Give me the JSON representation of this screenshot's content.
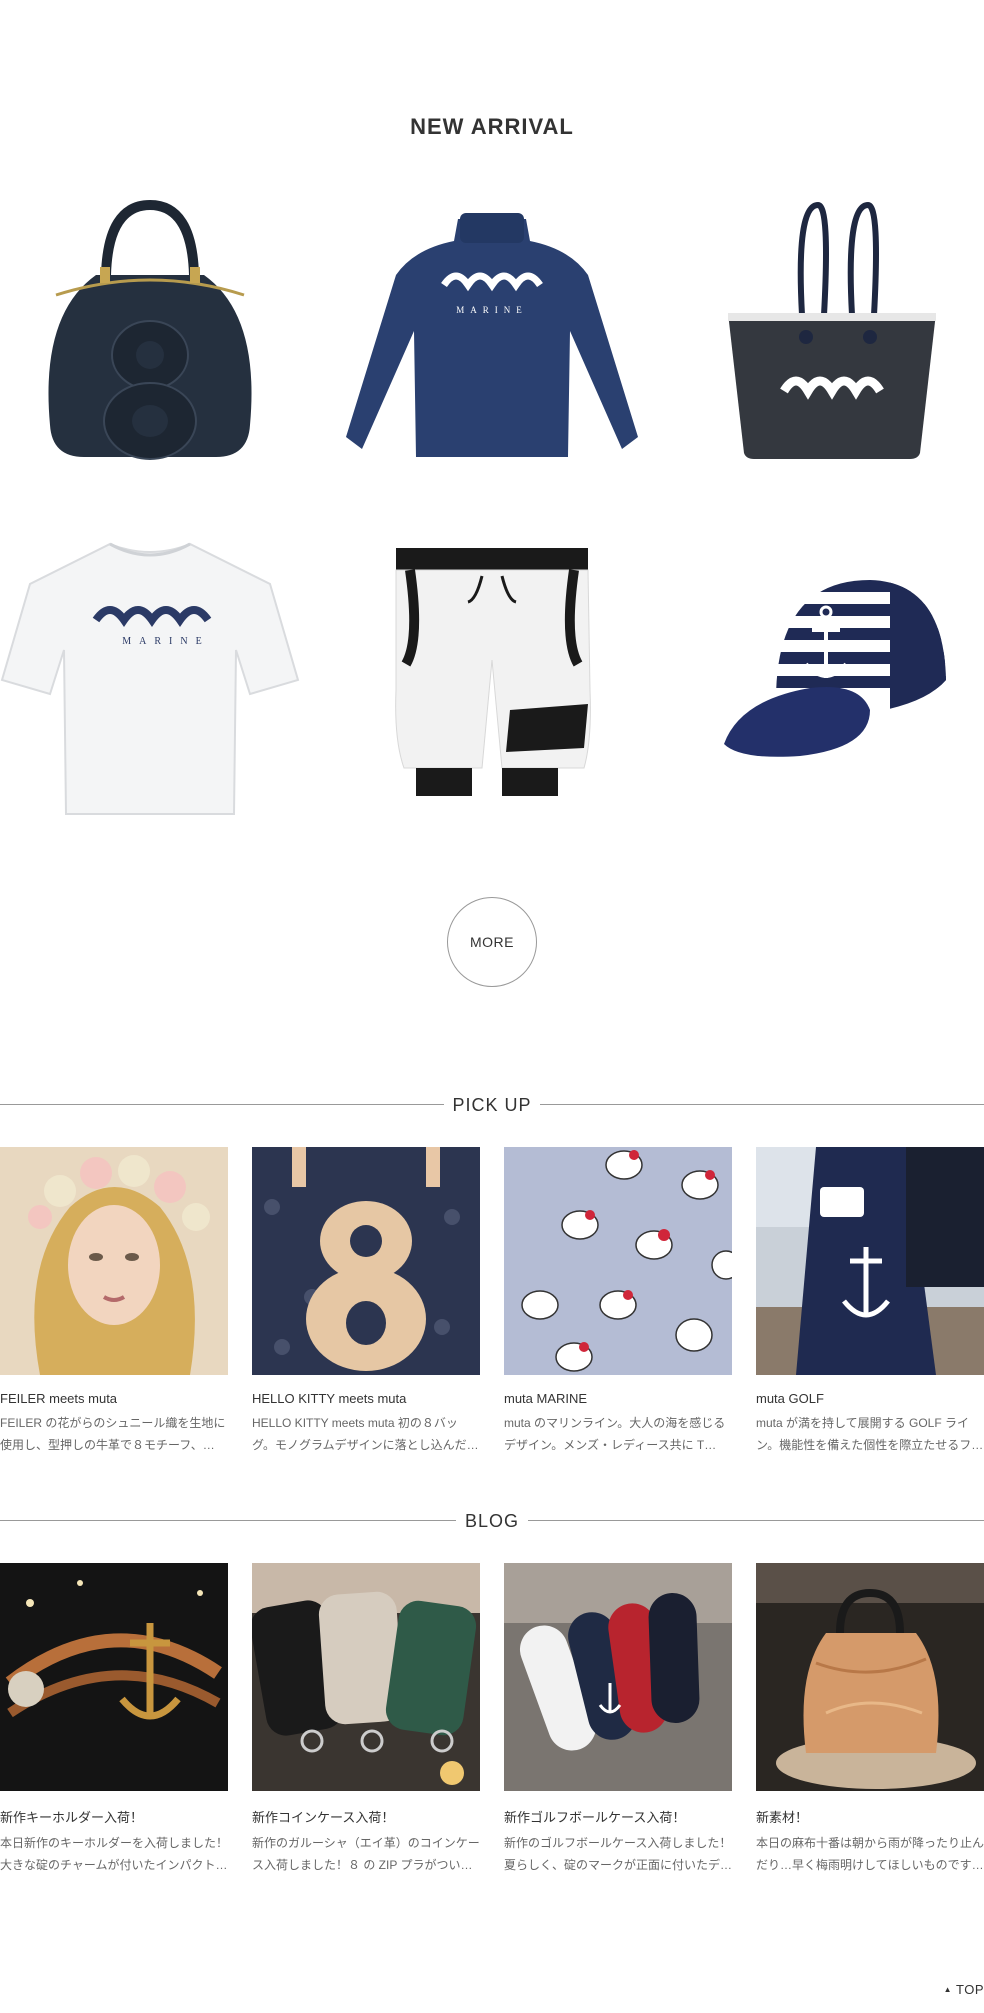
{
  "new_arrival": {
    "title": "NEW ARRIVAL",
    "more_label": "MORE",
    "items": [
      {
        "icon": "bowling-bag-8-icon"
      },
      {
        "icon": "navy-long-sleeve-shirt-icon"
      },
      {
        "icon": "tote-bag-icon"
      },
      {
        "icon": "white-tshirt-icon"
      },
      {
        "icon": "white-pants-icon"
      },
      {
        "icon": "anchor-cap-icon"
      }
    ]
  },
  "pick_up": {
    "title": "PICK UP",
    "cards": [
      {
        "title": "FEILER meets muta",
        "desc": "FEILER の花がらのシュニール織を生地に使用し、型押しの牛革で８モチーフ、…"
      },
      {
        "title": "HELLO KITTY meets muta",
        "desc": "HELLO KITTY meets muta 初の８バッグ。モノグラムデザインに落とし込んだ…"
      },
      {
        "title": "muta MARINE",
        "desc": "muta のマリンライン。大人の海を感じるデザイン。メンズ・レディース共に T…"
      },
      {
        "title": "muta GOLF",
        "desc": "muta が満を持して展開する GOLF ライン。機能性を備えた個性を際立たせるフ…"
      }
    ]
  },
  "blog": {
    "title": "BLOG",
    "cards": [
      {
        "title": "新作キーホルダー入荷！",
        "desc": "本日新作のキーホルダーを入荷しました！大きな碇のチャームが付いたインパクトの…"
      },
      {
        "title": "新作コインケース入荷！",
        "desc": "新作のガルーシャ（エイ革）のコインケース入荷しました！８ の ZIP プラがつい…"
      },
      {
        "title": "新作ゴルフボールケース入荷！",
        "desc": "新作のゴルフボールケース入荷しました！夏らしく、碇のマークが正面に付いたデ…"
      },
      {
        "title": "新素材！",
        "desc": "本日の麻布十番は朝から雨が降ったり止んだり…早く梅雨明けしてほしいものです…"
      }
    ]
  },
  "footer": {
    "top_label": "TOP"
  }
}
